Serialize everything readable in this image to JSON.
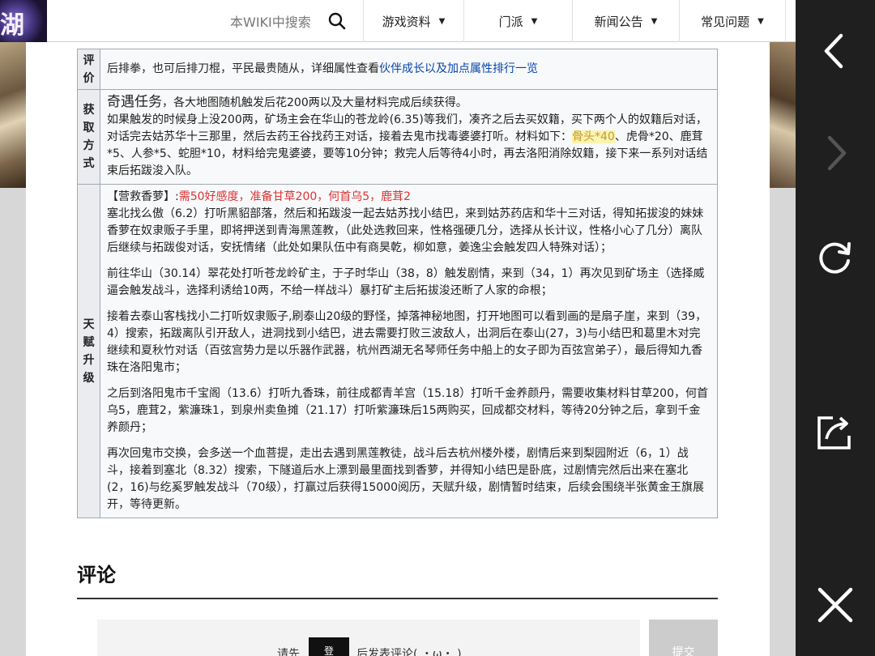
{
  "logo": {
    "char": "湖"
  },
  "search": {
    "placeholder": "本WIKI中搜索"
  },
  "nav": [
    {
      "label": "游戏资料"
    },
    {
      "label": "门派"
    },
    {
      "label": "新闻公告"
    },
    {
      "label": "常见问题"
    }
  ],
  "table": {
    "rows": [
      {
        "label": "评价",
        "text_before_link": "后排拳，也可后排刀棍，平民最贵随从，详细属性查看",
        "link_text": "伙伴成长以及加点属性排行一览"
      },
      {
        "label": "获取方式",
        "heading": "奇遇任务",
        "heading_suffix": "，各大地图随机触发后花200两以及大量材料完成后续获得。",
        "text_before_highlight": "如果触发的时候身上没200两，矿场主会在华山的苍龙岭(6.35)等我们，凑齐之后去买奴籍，买下两个人的奴籍后对话，对话完去姑苏华十三那里，然后去药王谷找药王对话，接着去鬼市找毒婆婆打听。材料如下：",
        "highlight": "骨头*40",
        "text_after_highlight": "、虎骨*20、鹿茸*5、人参*5、蛇胆*10，材料给完鬼婆婆，要等10分钟；救完人后等待4小时，再去洛阳消除奴籍，接下来一系列对话结束后拓跋浚入队。"
      },
      {
        "label": "天赋升级",
        "quest_prefix": "【营救香萝】:",
        "quest_requirement": "需50好感度，准备甘草200，何首乌5，鹿茸2",
        "paragraphs": [
          "塞北找么傲（6.2）打听黑貂部落，然后和拓跋浚一起去姑苏找小结巴，来到姑苏药店和华十三对话，得知拓拔浚的妹妹香萝在奴隶贩子手里，即将押送到青海黑莲教，（此处选救回来，性格强硬几分，选择从长计议，性格小心了几分）离队后继续与拓跋俊对话，安抚情绪（此处如果队伍中有商昊乾，柳如意，姜逸尘会触发四人特殊对话）；",
          "前往华山（30.14）翠花处打听苍龙岭矿主，于子时华山（38，8）触发剧情，来到（34，1）再次见到矿场主（选择威逼会触发战斗，选择利诱给10两，不给一样战斗）暴打矿主后拓拔浚还断了人家的命根；",
          "接着去泰山客栈找小二打听奴隶贩子,刷泰山20级的野怪，掉落神秘地图，打开地图可以看到画的是扇子崖，来到（39，4）搜索，拓跋离队引开敌人，进洞找到小结巴，进去需要打败三波敌人，出洞后在泰山(27，3)与小结巴和葛里木对完继续和夏秋竹对话（百弦宫势力是以乐器作武器，杭州西湖无名琴师任务中船上的女子即为百弦宫弟子），最后得知九香珠在洛阳鬼市；",
          "之后到洛阳鬼市千宝阁（13.6）打听九香珠，前往成都青羊宫（15.18）打听千金养颜丹，需要收集材料甘草200，何首乌5，鹿茸2，紫濂珠1，到泉州卖鱼摊（21.17）打听紫濂珠后15两购买，回成都交材料，等待20分钟之后，拿到千金养颜丹；",
          "再次回鬼市交换，会多送一个血菩提，走出去遇到黑莲教徒，战斗后去杭州楼外楼，剧情后来到梨园附近（6，1）战斗，接着到塞北（8.32）搜索，下隧道后水上漂到最里面找到香萝，并得知小结巴是卧底，过剧情完然后出来在塞北(2，16)与纥奚罗触发战斗（70级），打赢过后获得15000阅历，天赋升级，剧情暂时结束，后续会围绕半张黄金王旗展开，等待更新。"
        ]
      }
    ]
  },
  "comments": {
    "title": "评论",
    "prompt_before": "请先",
    "login_label": "登",
    "prompt_after": "后发表评论( ・ω・ )",
    "submit_label": "提交"
  },
  "side_panel": {
    "icons": [
      "back-icon",
      "forward-icon",
      "refresh-icon",
      "share-icon",
      "close-icon"
    ]
  },
  "colors": {
    "link": "#0645ad",
    "requirement_red": "#dd3333",
    "highlight_bg": "#fbf3b0",
    "side_panel_bg": "#1f1f1f"
  }
}
